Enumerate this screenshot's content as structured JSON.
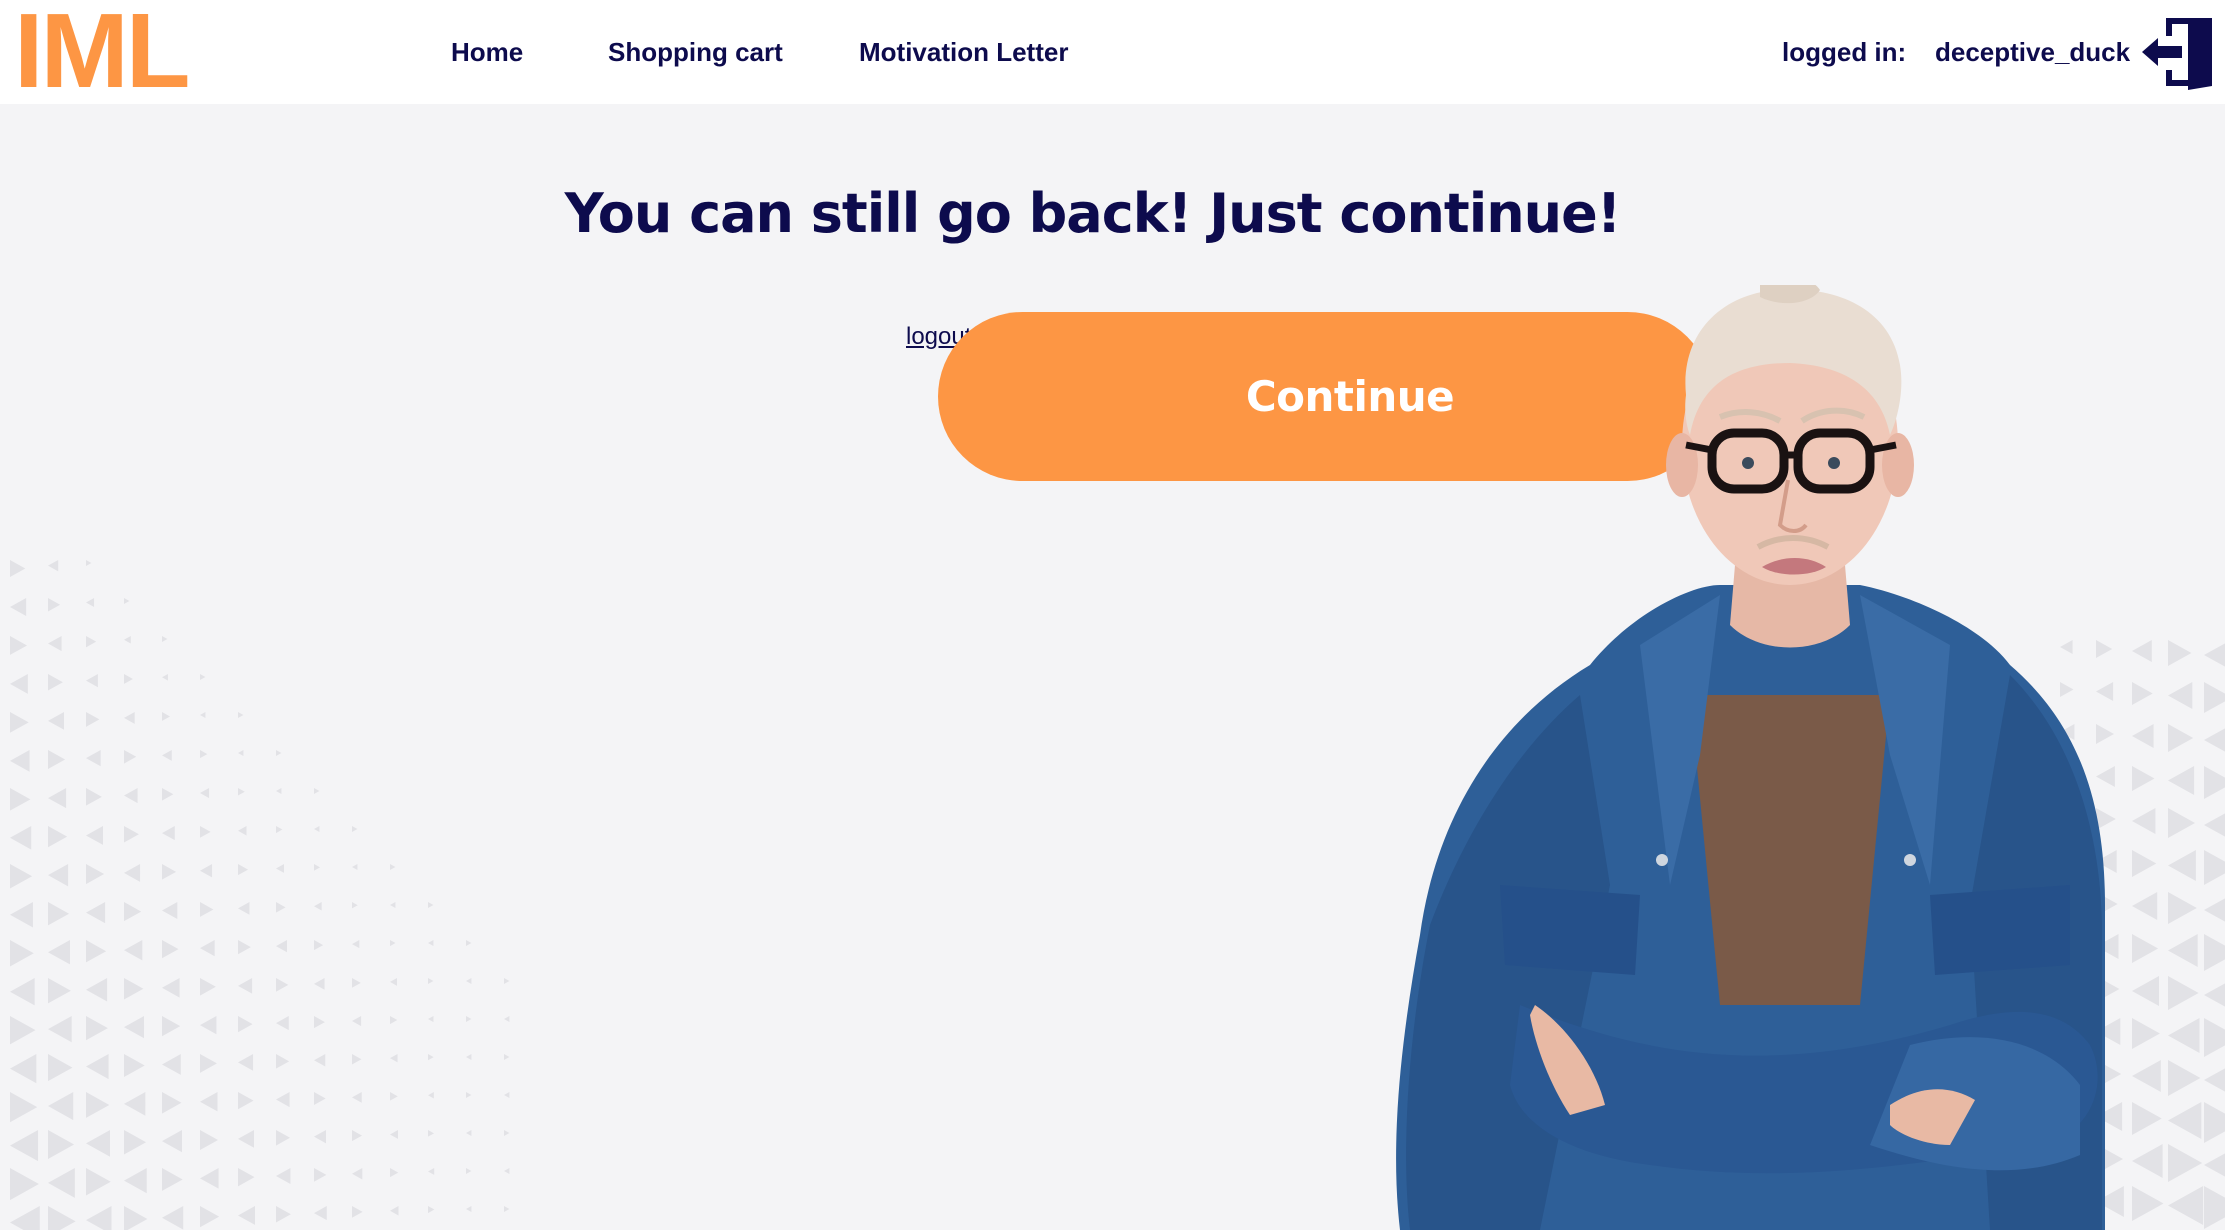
{
  "header": {
    "logo": "IML",
    "nav": [
      {
        "label": "Home"
      },
      {
        "label": "Shopping cart"
      },
      {
        "label": "Motivation Letter"
      }
    ],
    "logged_in_label": "logged in:",
    "username": "deceptive_duck",
    "logout_icon": "logout-door-icon"
  },
  "main": {
    "heading": "You can still go back! Just continue!",
    "logout_link": "logout",
    "continue_button": "Continue"
  },
  "colors": {
    "accent": "#fd9644",
    "text": "#0d0b4d",
    "background": "#f4f4f6",
    "header_bg": "#ffffff",
    "jacket": "#2e5f98"
  },
  "image": {
    "subject": "person-with-crossed-arms"
  }
}
